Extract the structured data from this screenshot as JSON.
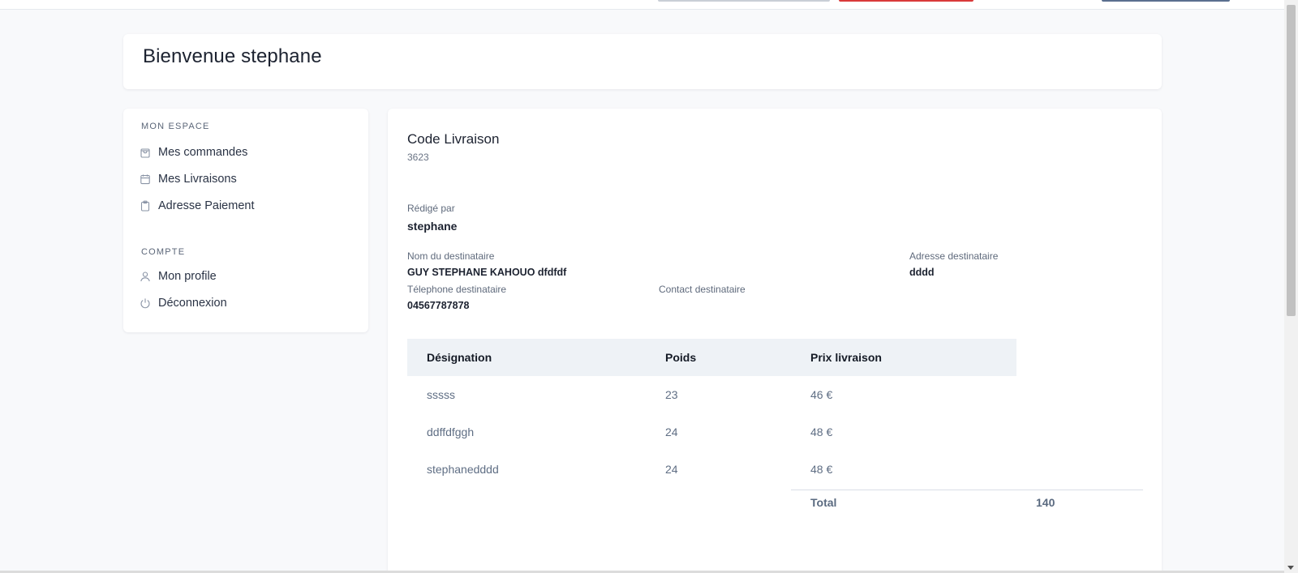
{
  "welcome": {
    "title": "Bienvenue stephane"
  },
  "sidebar": {
    "sections": [
      {
        "title": "MON ESPACE",
        "items": [
          {
            "label": "Mes commandes",
            "icon": "shopping-bag-icon"
          },
          {
            "label": "Mes Livraisons",
            "icon": "calendar-icon"
          },
          {
            "label": "Adresse Paiement",
            "icon": "clipboard-icon"
          }
        ]
      },
      {
        "title": "COMPTE",
        "items": [
          {
            "label": "Mon profile",
            "icon": "user-icon"
          },
          {
            "label": "Déconnexion",
            "icon": "power-icon"
          }
        ]
      }
    ]
  },
  "delivery": {
    "code_label": "Code Livraison",
    "code_value": "3623",
    "author_label": "Rédigé par",
    "author_value": "stephane",
    "recipient_name_label": "Nom du destinataire",
    "recipient_name_value": "GUY STEPHANE KAHOUO dfdfdf",
    "recipient_address_label": "Adresse destinataire",
    "recipient_address_value": "dddd",
    "recipient_phone_label": "Télephone destinataire",
    "recipient_phone_value": "04567787878",
    "recipient_contact_label": "Contact destinataire",
    "recipient_contact_value": ""
  },
  "table": {
    "headers": [
      "Désignation",
      "Poids",
      "Prix livraison"
    ],
    "rows": [
      [
        "sssss",
        "23",
        "46 €"
      ],
      [
        "ddffdfggh",
        "24",
        "48 €"
      ],
      [
        "stephanedddd",
        "24",
        "48 €"
      ]
    ],
    "total_label": "Total",
    "total_value": "140"
  },
  "colors": {
    "background": "#f8f9fb",
    "card": "#ffffff",
    "table_header": "#eef2f6",
    "muted_text": "#5f6e84",
    "topbar_red": "#d93a3a",
    "topbar_slate": "#5a6f8f"
  }
}
